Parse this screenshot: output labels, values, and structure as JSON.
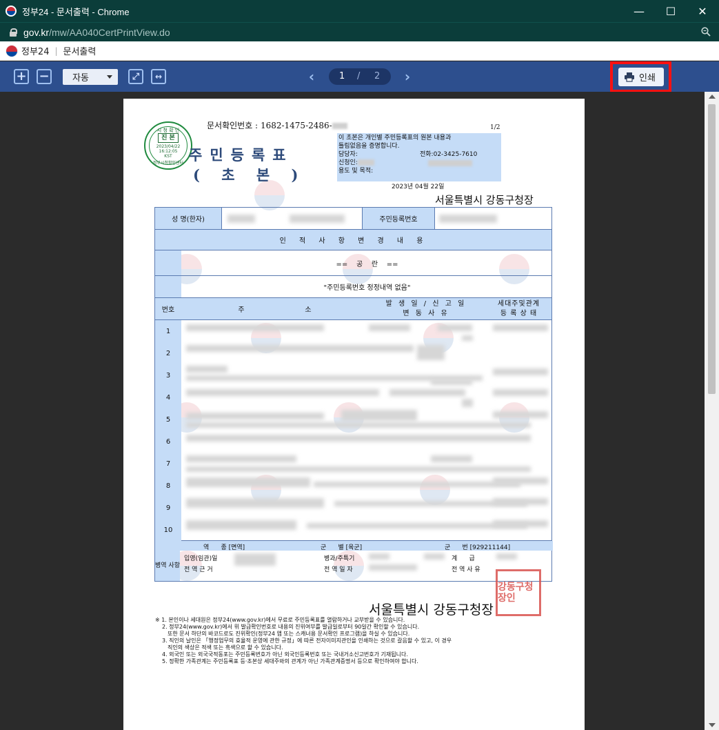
{
  "window": {
    "title": "정부24 - 문서출력 - Chrome",
    "minimize": "—",
    "maximize": "☐",
    "close": "✕"
  },
  "address": {
    "host": "gov.kr",
    "path": "/mw/AA040CertPrintView.do"
  },
  "page_header": {
    "brand": "정부24",
    "separator": "|",
    "title": "문서출력"
  },
  "toolbar": {
    "zoom_in": "+",
    "zoom_out": "−",
    "zoom_value": "자동",
    "fit_page": "⤢",
    "fit_width": "↔",
    "prev": "‹",
    "next": "›",
    "current_page": "1",
    "page_sep": "/",
    "total_pages": "2",
    "print_label": "인쇄"
  },
  "document": {
    "doc_number_label": "문서확인번호 :",
    "doc_number": "1682-1475-2486-",
    "page_fraction": "1/2",
    "title": "주민등록표",
    "subtitle": "( 초  본 )",
    "seal_green": {
      "top": "시 청 확 인",
      "mid": "진 본",
      "date": "2023/04/22",
      "time": "16:12:05",
      "tz": "KST",
      "bottom": "정부시청확인센터"
    },
    "info_box": {
      "line1": "이 초본은 개인별 주민등록표의 원본 내용과",
      "line2": "틀림없음을 증명합니다.",
      "manager_label": "담당자:",
      "phone": "전화:02-3425-7610",
      "applicant_label": "신청인:",
      "purpose_label": "용도 및 목적:"
    },
    "issue_date": "2023년 04월 22일",
    "issuer": "서울특별시 강동구청장",
    "table": {
      "name_label": "성 명(한자)",
      "rrn_label": "주민등록번호",
      "history_header": "인 적 사 항 변 경 내 용",
      "blank_marker": "==    공    란    ==",
      "correction_note": "\"주민등록번호 정정내역 없음\"",
      "col_no": "번호",
      "col_addr1": "주",
      "col_addr2": "소",
      "col_date1": "발 생 일 / 신 고 일",
      "col_date2": "변   동   사   유",
      "col_household1": "세대주및관계",
      "col_household2": "등 록 상 태",
      "rows": [
        "1",
        "2",
        "3",
        "4",
        "5",
        "6",
        "7",
        "8",
        "9",
        "10"
      ],
      "military": {
        "section": "병역 사항",
        "service_type": "역      종 [면역]",
        "branch": "군      별 [육군]",
        "number": "군      번 [929211144]",
        "enlist": "입영(임관)일",
        "discharge_basis": "전 역 근 거",
        "type_label": "병과/주특기",
        "discharge_date": "전 역 일 자",
        "rank": "계      급",
        "reason": "전 역 사 유"
      }
    },
    "footer_issuer": "서울특별시 강동구청장",
    "red_seal": "강동구청장인",
    "notes": [
      "※ 1. 본인이나 세대원은 정부24(www.gov.kr)에서 무료로 주민등록표를 열람하거나 교부받을 수 있습니다.",
      "2. 정부24(www.gov.kr)에서 위 발급확인번호로 내용의 진위여부를 발급일로부터 90일간 확인할 수 있습니다.",
      "또한 문서 하단의 바코드로도 진위확인(정부24 앱 또는 스캐너용 문서확인 프로그램)을 하실 수 있습니다.",
      "3. 직인의 날인은 「행정업무의 효율적 운영에 관한 규정」에 따른 전자이미지관인을 인쇄하는 것으로 갈음할 수 있고, 이 경우",
      "직인의 색상은 적색 또는 흑색으로 할 수 있습니다.",
      "4. 외국인 또는 외국국적동포는 주민등록번호가 아닌 외국인등록번호 또는 국내거소신고번호가 기재됩니다.",
      "5. 정확한 가족관계는 주민등록표 등·초본상 세대주와의 관계가 아닌 가족관계증명서 등으로 확인하여야 합니다."
    ]
  }
}
